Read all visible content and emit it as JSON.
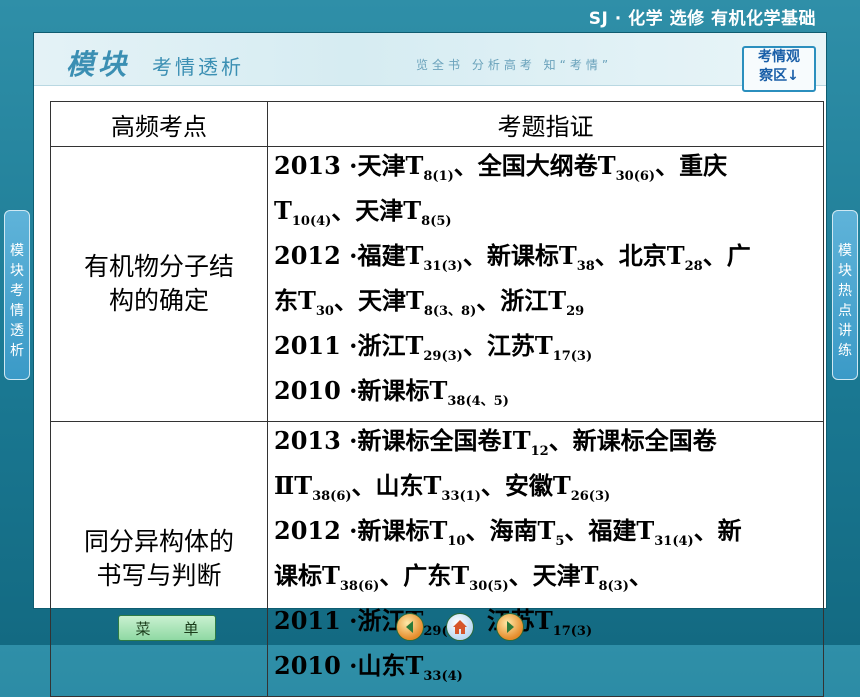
{
  "header": {
    "course_title": "SJ · 化学  选修  有机化学基础"
  },
  "banner": {
    "title_main": "模块",
    "title_rest": "考情透析",
    "subtitle": "览全书  分析高考  知“考情”",
    "badge_line1": "考情观",
    "badge_line2": "察区↓"
  },
  "table": {
    "col1_header": "高频考点",
    "col2_header": "考题指证",
    "rows": [
      {
        "label_line1": "有机物分子结",
        "label_line2": "构的确定",
        "lines": [
          [
            "2013 ·天津T",
            "8(1)",
            "、全国大纲卷T",
            "30(6)",
            "、重庆"
          ],
          [
            "T",
            "10(4)",
            "、天津T",
            "8(5)"
          ],
          [
            " 2012 ·福建T",
            "31(3)",
            "、新课标T",
            "38",
            "、北京T",
            "28",
            "、广"
          ],
          [
            "东T",
            "30",
            "、天津T",
            "8(3、8)",
            "、浙江T",
            "29"
          ],
          [
            "2011 ·浙江T",
            "29(3)",
            "、江苏T",
            "17(3)"
          ],
          [
            "2010 ·新课标T",
            "38(4、5)"
          ]
        ]
      },
      {
        "label_line1": "同分异构体的",
        "label_line2": "书写与判断",
        "lines": [
          [
            "2013 ·新课标全国卷ⅠT",
            "12",
            "、新课标全国卷"
          ],
          [
            "ⅡT",
            "38(6)",
            "、山东T",
            "33(1)",
            "、安徽T",
            "26(3)"
          ],
          [
            "2012 ·新课标T",
            "10",
            "、海南T",
            "5",
            "、福建T",
            "31(4)",
            "、新"
          ],
          [
            "课标T",
            "38(6)",
            "、广东T",
            "30(5)",
            "、天津T",
            "8(3)",
            "、"
          ],
          [
            "2011 ·浙江T",
            "29(6)",
            "、江苏T",
            "17(3)"
          ],
          [
            "2010 ·山东T",
            "33(4)"
          ]
        ]
      }
    ]
  },
  "left_tab": "模块考情透析",
  "right_tab": "模块热点讲练",
  "footer": {
    "menu_char1": "菜",
    "menu_char2": "单"
  },
  "icons": [
    "prev-icon",
    "home-icon",
    "next-icon"
  ]
}
